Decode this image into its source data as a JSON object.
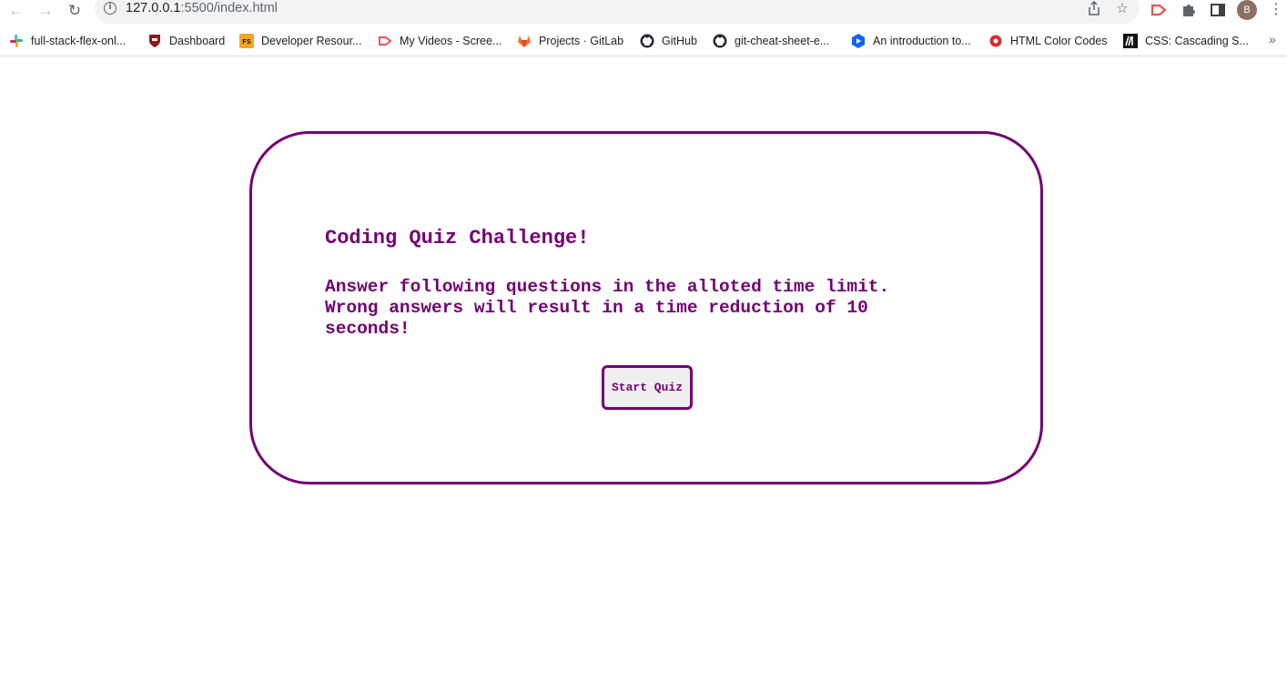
{
  "browser": {
    "url_host": "127.0.0.1",
    "url_rest": ":5500/index.html",
    "avatar_letter": "B",
    "icons": {
      "back": "arrow-left-icon",
      "forward": "arrow-right-icon",
      "reload": "reload-icon",
      "info": "info-icon",
      "share": "share-icon",
      "star": "star-icon",
      "extension_red": "screencastify-icon",
      "puzzle": "puzzle-icon",
      "sidepanel": "side-panel-icon",
      "menu": "kebab-menu-icon"
    }
  },
  "bookmarks": [
    {
      "label": "full-stack-flex-onl...",
      "icon": "slack-icon"
    },
    {
      "label": "Dashboard",
      "icon": "shield-icon"
    },
    {
      "label": "Developer Resour...",
      "icon": "fs-icon"
    },
    {
      "label": "My Videos - Scree...",
      "icon": "screencastify-icon"
    },
    {
      "label": "Projects · GitLab",
      "icon": "gitlab-icon"
    },
    {
      "label": "GitHub",
      "icon": "github-icon"
    },
    {
      "label": "git-cheat-sheet-e...",
      "icon": "github-icon"
    },
    {
      "label": "An introduction to...",
      "icon": "play-icon"
    },
    {
      "label": "HTML Color Codes",
      "icon": "color-icon"
    },
    {
      "label": "CSS: Cascading S...",
      "icon": "mdn-icon"
    }
  ],
  "bookmarks_more": "»",
  "quiz": {
    "title": "Coding Quiz Challenge!",
    "description": "Answer following questions in the alloted time limit. Wrong answers will result in a time reduction of 10 seconds!",
    "start_label": "Start Quiz"
  },
  "colors": {
    "accent": "#730073",
    "button_bg": "#efefef"
  }
}
